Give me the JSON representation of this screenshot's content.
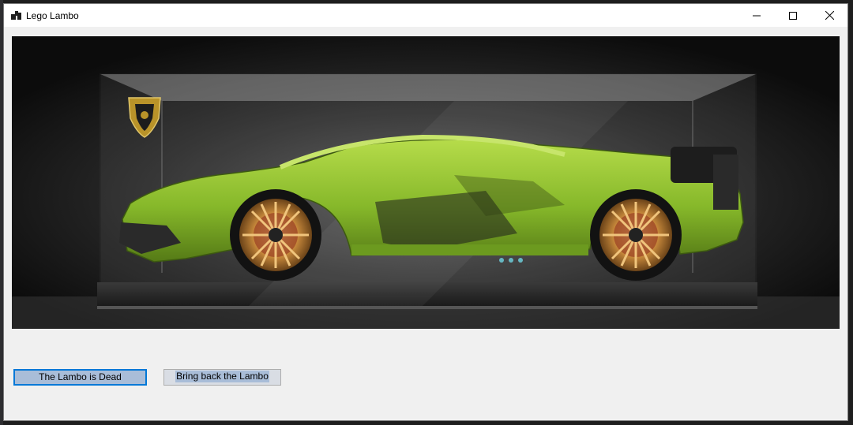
{
  "window": {
    "title": "Lego Lambo",
    "controls": {
      "minimize_icon": "minimize-icon",
      "maximize_icon": "maximize-icon",
      "close_icon": "close-icon"
    }
  },
  "picture": {
    "subject_icon": "lego-lamborghini-in-display-case",
    "body_color": "#86b82a",
    "wheel_color": "#c98a3c"
  },
  "buttons": {
    "dead_label": "The Lambo is Dead",
    "back_label": "Bring back the Lambo"
  },
  "colors": {
    "focus_border": "#0078d7",
    "button_fill": "#a9bdd8",
    "form_background": "#f0f0f0"
  }
}
